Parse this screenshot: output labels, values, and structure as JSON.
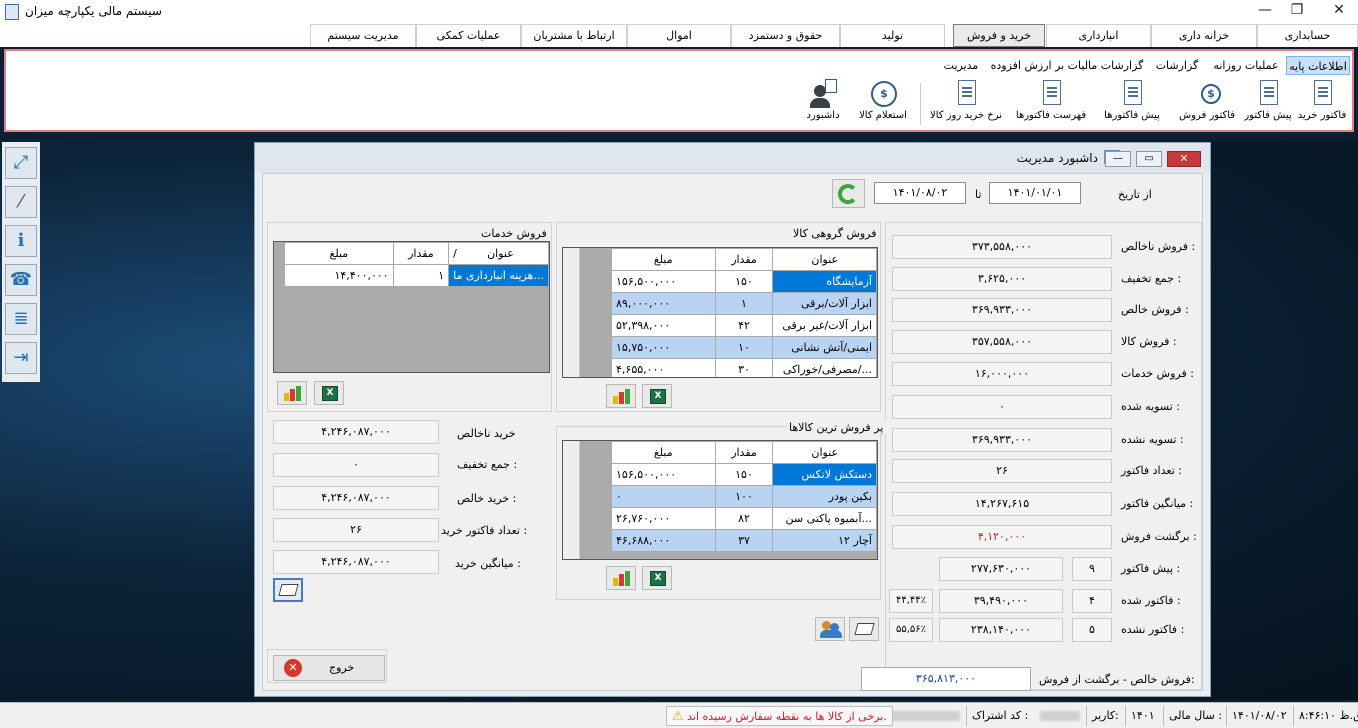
{
  "window": {
    "title": "سیستم مالی یکپارچه میزان",
    "controls": [
      "—",
      "❐",
      "✕"
    ]
  },
  "menu": {
    "tabs": [
      "حسابداری",
      "خزانه داری",
      "انبارداری",
      "خرید و فروش",
      "تولید",
      "حقوق و دستمزد",
      "اموال",
      "ارتباط با مشتریان",
      "عملیات کمکی",
      "مدیریت سیستم"
    ],
    "active": "خرید و فروش"
  },
  "ribbon": {
    "tabs": [
      "اطلاعات پایه",
      "عملیات روزانه",
      "گزارشات",
      "گزارشات مالیات بر ارزش افزوده",
      "مدیریت"
    ],
    "active": "اطلاعات پایه",
    "icons": [
      {
        "label": "فاکتور خرید",
        "icon": "document-icon"
      },
      {
        "label": "پیش فاکتور",
        "icon": "pre-invoice-icon"
      },
      {
        "label": "فاکتور فروش",
        "icon": "sales-invoice-icon"
      },
      {
        "label": "پیش فاکتورها",
        "icon": "checklist-icon"
      },
      {
        "label": "فهرست فاکتورها",
        "icon": "invoice-list-icon"
      },
      {
        "label": "نرخ خرید روز کالا",
        "icon": "rate-icon"
      },
      {
        "label": "استعلام کالا",
        "icon": "inquiry-icon"
      },
      {
        "label": "داشبورد",
        "icon": "dashboard-user-icon"
      }
    ]
  },
  "sidebar": {
    "buttons": [
      "expand-icon",
      "wand-icon",
      "info-icon",
      "phone-icon",
      "notes-icon",
      "exit-icon"
    ]
  },
  "dialog": {
    "title": "داشبورد مدیریت",
    "controls": [
      "—",
      "▭",
      "✕"
    ],
    "from_label": "از تاریخ",
    "from_date": "۱۴۰۱/۰۱/۰۱",
    "to_label": "تا",
    "to_date": "۱۴۰۱/۰۸/۰۲",
    "summary": [
      {
        "label": "فروش ناخالص :",
        "value": "۳۷۳,۵۵۸,۰۰۰"
      },
      {
        "label": "جمع تخفیف :",
        "value": "۳,۶۲۵,۰۰۰"
      },
      {
        "label": "فروش خالص :",
        "value": "۳۶۹,۹۳۳,۰۰۰"
      },
      {
        "label": "فروش کالا :",
        "value": "۳۵۷,۵۵۸,۰۰۰"
      },
      {
        "label": "فروش خدمات :",
        "value": "۱۶,۰۰۰,۰۰۰"
      },
      {
        "label": "تسویه شده :",
        "value": "۰"
      },
      {
        "label": "تسویه نشده :",
        "value": "۳۶۹,۹۳۳,۰۰۰"
      },
      {
        "label": "تعداد فاکتور :",
        "value": "۲۶"
      },
      {
        "label": "میانگین فاکتور :",
        "value": "۱۴,۲۶۷,۶۱۵"
      },
      {
        "label": "برگشت فروش :",
        "value": "۴,۱۲۰,۰۰۰"
      }
    ],
    "pre_invoice": {
      "label": "پیش فاکتور :",
      "count": "۹",
      "value": "۲۷۷,۶۳۰,۰۰۰"
    },
    "invoiced": {
      "label": "فاکتور شده :",
      "count": "۴",
      "value": "۳۹,۴۹۰,۰۰۰",
      "percent": "۴۴,۴۴٪"
    },
    "not_invoiced": {
      "label": "فاکتور نشده :",
      "count": "۵",
      "value": "۲۳۸,۱۴۰,۰۰۰",
      "percent": "۵۵,۵۶٪"
    },
    "net_label": "فروش خالص - برگشت از فروش:",
    "net_value": "۳۶۵,۸۱۳,۰۰۰",
    "group_sales": {
      "title": "فروش گروهی کالا",
      "columns": [
        "عنوان",
        "مقدار",
        "مبلغ"
      ],
      "rows": [
        [
          "آزمایشگاه",
          "۱۵۰",
          "۱۵۶,۵۰۰,۰۰۰"
        ],
        [
          "ابزار آلات/برقی",
          "۱",
          "۸۹,۰۰۰,۰۰۰"
        ],
        [
          "ابزار آلات/غیر برقی",
          "۴۲",
          "۵۲,۳۹۸,۰۰۰"
        ],
        [
          "ایمنی/آتش نشانی",
          "۱۰",
          "۱۵,۷۵۰,۰۰۰"
        ],
        [
          "مصرفی/خوراکی/...",
          "۳۰",
          "۴,۶۵۵,۰۰۰"
        ]
      ]
    },
    "services": {
      "title": "فروش خدمات",
      "columns": [
        "عنوان",
        "/",
        "مقدار",
        "مبلغ"
      ],
      "rows": [
        [
          "هزینه انبارداری ما...",
          "۱",
          "۱۴,۴۰۰,۰۰۰"
        ]
      ]
    },
    "top_sellers": {
      "title": "پر فروش ترین کالاها",
      "columns": [
        "عنوان",
        "مقدار",
        "مبلغ"
      ],
      "rows": [
        [
          "دستکش لاتکس",
          "۱۵۰",
          "۱۵۶,۵۰۰,۰۰۰"
        ],
        [
          "بکین پودر",
          "۱۰۰",
          "۰"
        ],
        [
          "آبمیوه پاکتی سن...",
          "۸۲",
          "۲۶,۷۶۰,۰۰۰"
        ],
        [
          "آچار ۱۲",
          "۳۷",
          "۴۶,۶۸۸,۰۰۰"
        ]
      ]
    },
    "purchase": [
      {
        "label": "خرید ناخالص",
        "value": "۴,۲۴۶,۰۸۷,۰۰۰"
      },
      {
        "label": "جمع تخفیف :",
        "value": "۰"
      },
      {
        "label": "خرید خالص :",
        "value": "۴,۲۴۶,۰۸۷,۰۰۰"
      },
      {
        "label": "تعداد فاکتور خرید :",
        "value": "۲۶"
      },
      {
        "label": "میانگین خرید :",
        "value": "۴,۲۴۶,۰۸۷,۰۰۰"
      }
    ],
    "exit_label": "خروج"
  },
  "status": {
    "time": "۸:۴۶:۱۰ ق.ظ",
    "date": "۱۴۰۱/۰۸/۰۲",
    "year_label": "سال مالی :",
    "year": "۱۴۰۱",
    "user_label": "کاربر:",
    "subscription_label": "کد اشتراک :",
    "warning": "برخی از کالا ها به نقطه سفارش رسیده اند."
  },
  "colors": {
    "accent": "#0078d7",
    "ribbon_border": "#e47c8a",
    "alert": "#d9182b",
    "net_value": "#1a3fa7"
  }
}
